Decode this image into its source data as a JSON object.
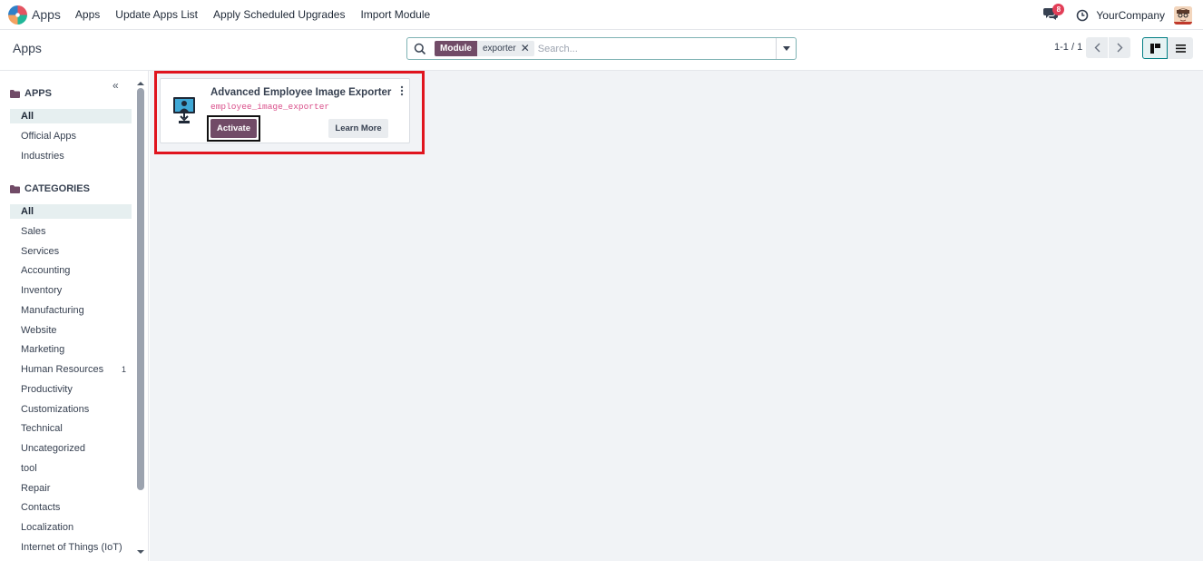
{
  "navbar": {
    "brand": "Apps",
    "menu": [
      "Apps",
      "Update Apps List",
      "Apply Scheduled Upgrades",
      "Import Module"
    ],
    "messages_badge": "8",
    "company": "YourCompany"
  },
  "control_panel": {
    "title": "Apps",
    "search": {
      "facet_label": "Module",
      "facet_value": "exporter",
      "placeholder": "Search..."
    },
    "pager": "1-1 / 1"
  },
  "sidebar": {
    "apps_heading": "APPS",
    "apps": [
      {
        "label": "All",
        "active": true
      },
      {
        "label": "Official Apps",
        "active": false
      },
      {
        "label": "Industries",
        "active": false
      }
    ],
    "categories_heading": "CATEGORIES",
    "categories": [
      {
        "label": "All",
        "active": true,
        "count": ""
      },
      {
        "label": "Sales",
        "active": false,
        "count": ""
      },
      {
        "label": "Services",
        "active": false,
        "count": ""
      },
      {
        "label": "Accounting",
        "active": false,
        "count": ""
      },
      {
        "label": "Inventory",
        "active": false,
        "count": ""
      },
      {
        "label": "Manufacturing",
        "active": false,
        "count": ""
      },
      {
        "label": "Website",
        "active": false,
        "count": ""
      },
      {
        "label": "Marketing",
        "active": false,
        "count": ""
      },
      {
        "label": "Human Resources",
        "active": false,
        "count": "1"
      },
      {
        "label": "Productivity",
        "active": false,
        "count": ""
      },
      {
        "label": "Customizations",
        "active": false,
        "count": ""
      },
      {
        "label": "Technical",
        "active": false,
        "count": ""
      },
      {
        "label": "Uncategorized",
        "active": false,
        "count": ""
      },
      {
        "label": "tool",
        "active": false,
        "count": ""
      },
      {
        "label": "Repair",
        "active": false,
        "count": ""
      },
      {
        "label": "Contacts",
        "active": false,
        "count": ""
      },
      {
        "label": "Localization",
        "active": false,
        "count": ""
      },
      {
        "label": "Internet of Things (IoT)",
        "active": false,
        "count": ""
      }
    ]
  },
  "module_card": {
    "title": "Advanced Employee Image Exporter",
    "technical_name": "employee_image_exporter",
    "activate_label": "Activate",
    "learn_more_label": "Learn More"
  },
  "colors": {
    "primary": "#714b67",
    "highlight": "#e0141e",
    "technical_name": "#d94f8a",
    "active_view": "#017e84"
  }
}
